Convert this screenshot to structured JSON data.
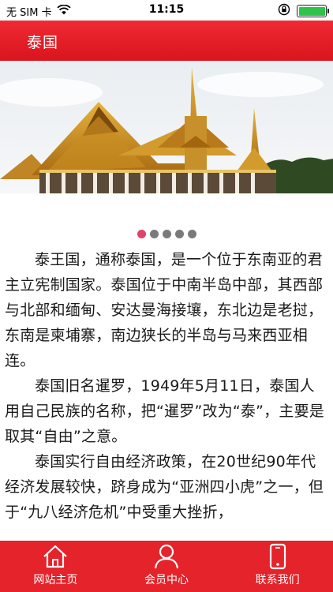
{
  "status_bar": {
    "carrier": "无 SIM 卡",
    "time": "11:15",
    "wifi_icon": "wifi-icon",
    "lock_icon": "orientation-lock-icon",
    "battery_level": 1.0
  },
  "header": {
    "title": "泰国"
  },
  "banner": {
    "slide_count": 5,
    "active_index": 0
  },
  "article": {
    "paragraphs": [
      "泰王国，通称泰国，是一个位于东南亚的君主立宪制国家。泰国位于中南半岛中部，其西部与北部和缅甸、安达曼海接壤，东北边是老挝，东南是柬埔寨，南边狭长的半岛与马来西亚相连。",
      "泰国旧名暹罗，1949年5月11日，泰国人用自己民族的名称，把“暹罗”改为“泰”，主要是取其“自由”之意。",
      "泰国实行自由经济政策，在20世纪90年代经济发展较快，跻身成为“亚洲四小虎”之一，但于“九八经济危机”中受重大挫折，"
    ]
  },
  "tabbar": {
    "items": [
      {
        "label": "网站主页",
        "icon": "home-icon"
      },
      {
        "label": "会员中心",
        "icon": "user-icon"
      },
      {
        "label": "联系我们",
        "icon": "phone-icon"
      }
    ]
  },
  "colors": {
    "brand_red": "#e4232b",
    "active_dot": "#e0426a",
    "inactive_dot": "#7a7a7a"
  }
}
